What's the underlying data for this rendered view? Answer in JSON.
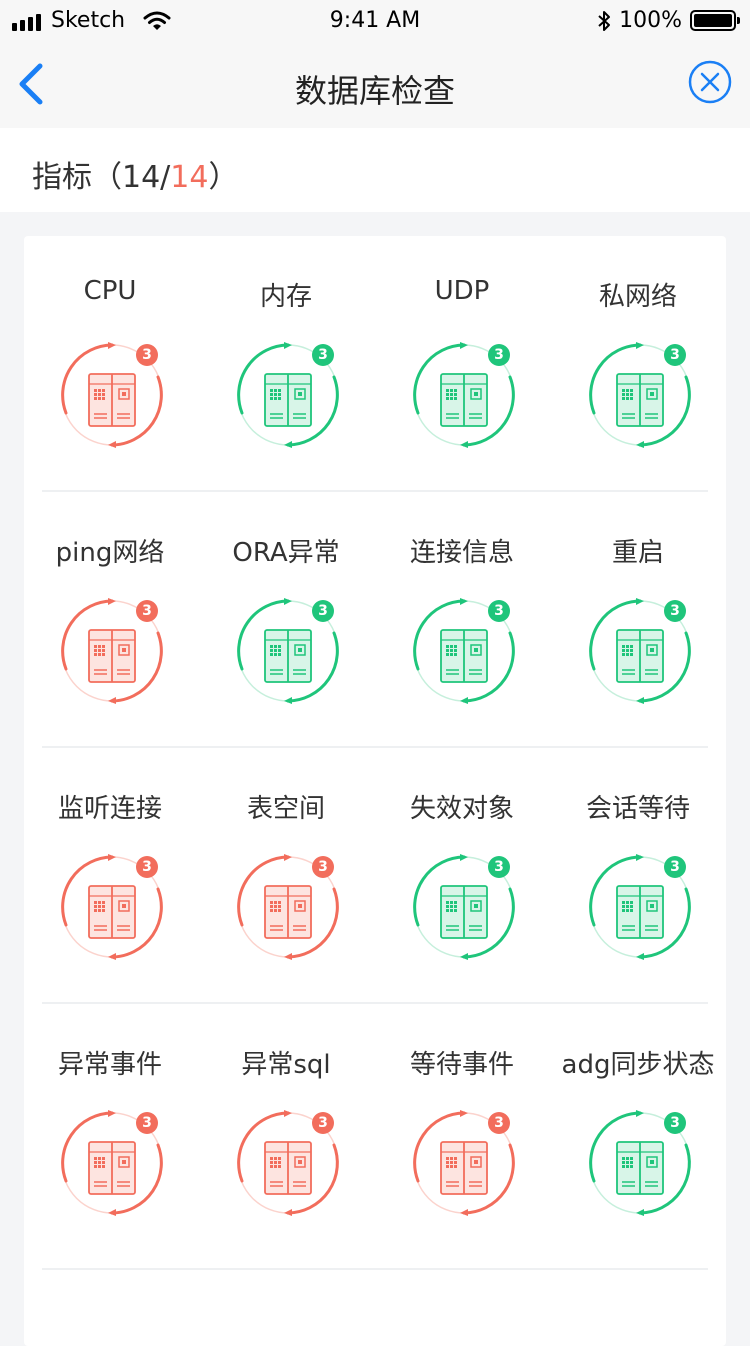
{
  "status_bar": {
    "carrier": "Sketch",
    "time": "9:41 AM",
    "battery": "100%"
  },
  "nav": {
    "title": "数据库检查",
    "back_icon": "chevron-left-icon",
    "close_icon": "close-circle-icon"
  },
  "summary": {
    "prefix": "指标（14/",
    "highlight": "14",
    "suffix": "）"
  },
  "colors": {
    "accent_blue": "#1a7ff5",
    "alert_red": "#f26d5c",
    "ok_green": "#1fc57b"
  },
  "metrics": [
    {
      "label": "CPU",
      "count": "3",
      "status": "alert"
    },
    {
      "label": "内存",
      "count": "3",
      "status": "ok"
    },
    {
      "label": "UDP",
      "count": "3",
      "status": "ok"
    },
    {
      "label": "私网络",
      "count": "3",
      "status": "ok"
    },
    {
      "label": "ping网络",
      "count": "3",
      "status": "alert"
    },
    {
      "label": "ORA异常",
      "count": "3",
      "status": "ok"
    },
    {
      "label": "连接信息",
      "count": "3",
      "status": "ok"
    },
    {
      "label": "重启",
      "count": "3",
      "status": "ok"
    },
    {
      "label": "监听连接",
      "count": "3",
      "status": "alert"
    },
    {
      "label": "表空间",
      "count": "3",
      "status": "alert"
    },
    {
      "label": "失效对象",
      "count": "3",
      "status": "ok"
    },
    {
      "label": "会话等待",
      "count": "3",
      "status": "ok"
    },
    {
      "label": "异常事件",
      "count": "3",
      "status": "alert"
    },
    {
      "label": "异常sql",
      "count": "3",
      "status": "alert"
    },
    {
      "label": "等待事件",
      "count": "3",
      "status": "alert"
    },
    {
      "label": "adg同步状态",
      "count": "3",
      "status": "ok"
    }
  ]
}
